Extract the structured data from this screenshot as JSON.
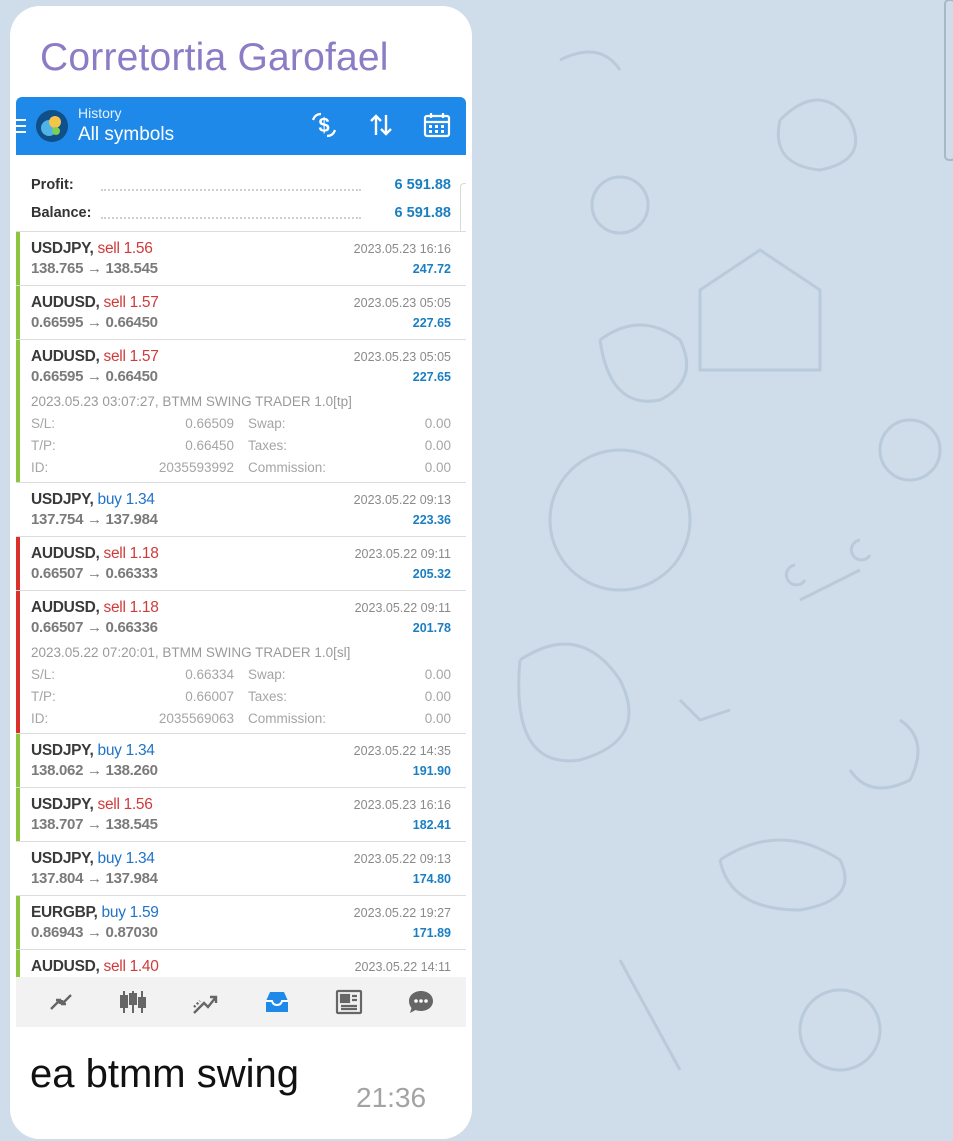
{
  "chat": {
    "sender_name": "Corretortia Garofael",
    "caption": "ea btmm swing",
    "time": "21:36"
  },
  "app": {
    "subtitle": "History",
    "title": "All symbols",
    "toolbar_icons": [
      "dollar-exchange-icon",
      "sort-icon",
      "calendar-icon"
    ]
  },
  "summary": {
    "profit_label": "Profit:",
    "profit_value": "6 591.88",
    "balance_label": "Balance:",
    "balance_value": "6 591.88"
  },
  "deals": [
    {
      "symbol": "USDJPY,",
      "side": "sell 1.56",
      "prices": "138.765 → 138.545",
      "time": "2023.05.23 16:16",
      "profit": "247.72",
      "bar": "#8cc63e"
    },
    {
      "symbol": "AUDUSD,",
      "side": "sell 1.57",
      "prices": "0.66595 → 0.66450",
      "time": "2023.05.23 05:05",
      "profit": "227.65",
      "bar": "#8cc63e"
    },
    {
      "symbol": "AUDUSD,",
      "side": "sell 1.57",
      "prices": "0.66595 → 0.66450",
      "time": "2023.05.23 05:05",
      "profit": "227.65",
      "bar": "#8cc63e",
      "comment": "2023.05.23 03:07:27, BTMM SWING TRADER 1.0[tp]",
      "sl_label": "S/L:",
      "sl": "0.66509",
      "tp_label": "T/P:",
      "tp": "0.66450",
      "id_label": "ID:",
      "id": "2035593992",
      "swap_label": "Swap:",
      "swap": "0.00",
      "taxes_label": "Taxes:",
      "taxes": "0.00",
      "commission_label": "Commission:",
      "commission": "0.00"
    },
    {
      "symbol": "USDJPY,",
      "side": "buy 1.34",
      "prices": "137.754 → 137.984",
      "time": "2023.05.22 09:13",
      "profit": "223.36",
      "bar": "#ffffff"
    },
    {
      "symbol": "AUDUSD,",
      "side": "sell 1.18",
      "prices": "0.66507 → 0.66333",
      "time": "2023.05.22 09:11",
      "profit": "205.32",
      "bar": "#d9302b"
    },
    {
      "symbol": "AUDUSD,",
      "side": "sell 1.18",
      "prices": "0.66507 → 0.66336",
      "time": "2023.05.22 09:11",
      "profit": "201.78",
      "bar": "#d9302b",
      "comment": "2023.05.22 07:20:01, BTMM SWING TRADER 1.0[sl]",
      "sl_label": "S/L:",
      "sl": "0.66334",
      "tp_label": "T/P:",
      "tp": "0.66007",
      "id_label": "ID:",
      "id": "2035569063",
      "swap_label": "Swap:",
      "swap": "0.00",
      "taxes_label": "Taxes:",
      "taxes": "0.00",
      "commission_label": "Commission:",
      "commission": "0.00"
    },
    {
      "symbol": "USDJPY,",
      "side": "buy 1.34",
      "prices": "138.062 → 138.260",
      "time": "2023.05.22 14:35",
      "profit": "191.90",
      "bar": "#8cc63e"
    },
    {
      "symbol": "USDJPY,",
      "side": "sell 1.56",
      "prices": "138.707 → 138.545",
      "time": "2023.05.23 16:16",
      "profit": "182.41",
      "bar": "#8cc63e"
    },
    {
      "symbol": "USDJPY,",
      "side": "buy 1.34",
      "prices": "137.804 → 137.984",
      "time": "2023.05.22 09:13",
      "profit": "174.80",
      "bar": "#ffffff"
    },
    {
      "symbol": "EURGBP,",
      "side": "buy 1.59",
      "prices": "0.86943 → 0.87030",
      "time": "2023.05.22 19:27",
      "profit": "171.89",
      "bar": "#8cc63e"
    },
    {
      "symbol": "AUDUSD,",
      "side": "sell 1.40",
      "prices": "",
      "time": "2023.05.22 14:11",
      "profit": "",
      "bar": "#8cc63e"
    }
  ],
  "bottom_nav": [
    "quotes-icon",
    "chart-candles-icon",
    "trade-icon",
    "history-icon",
    "news-icon",
    "chat-icon"
  ],
  "colors": {
    "accent": "#1e89e8",
    "profit_blue": "#1a7fc2",
    "sell_red": "#d03a3a",
    "buy_blue": "#1f73c8",
    "win_bar": "#8cc63e",
    "loss_bar": "#d9302b",
    "sender": "#8c7cc6"
  }
}
